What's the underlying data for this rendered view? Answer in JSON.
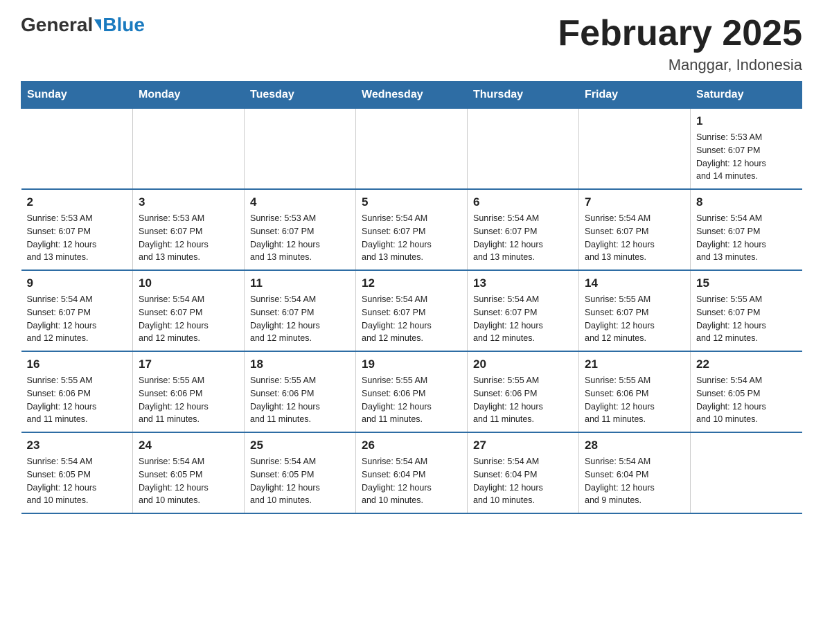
{
  "header": {
    "logo_general": "General",
    "logo_blue": "Blue",
    "title": "February 2025",
    "subtitle": "Manggar, Indonesia"
  },
  "days_of_week": [
    "Sunday",
    "Monday",
    "Tuesday",
    "Wednesday",
    "Thursday",
    "Friday",
    "Saturday"
  ],
  "weeks": [
    [
      {
        "day": "",
        "info": ""
      },
      {
        "day": "",
        "info": ""
      },
      {
        "day": "",
        "info": ""
      },
      {
        "day": "",
        "info": ""
      },
      {
        "day": "",
        "info": ""
      },
      {
        "day": "",
        "info": ""
      },
      {
        "day": "1",
        "info": "Sunrise: 5:53 AM\nSunset: 6:07 PM\nDaylight: 12 hours\nand 14 minutes."
      }
    ],
    [
      {
        "day": "2",
        "info": "Sunrise: 5:53 AM\nSunset: 6:07 PM\nDaylight: 12 hours\nand 13 minutes."
      },
      {
        "day": "3",
        "info": "Sunrise: 5:53 AM\nSunset: 6:07 PM\nDaylight: 12 hours\nand 13 minutes."
      },
      {
        "day": "4",
        "info": "Sunrise: 5:53 AM\nSunset: 6:07 PM\nDaylight: 12 hours\nand 13 minutes."
      },
      {
        "day": "5",
        "info": "Sunrise: 5:54 AM\nSunset: 6:07 PM\nDaylight: 12 hours\nand 13 minutes."
      },
      {
        "day": "6",
        "info": "Sunrise: 5:54 AM\nSunset: 6:07 PM\nDaylight: 12 hours\nand 13 minutes."
      },
      {
        "day": "7",
        "info": "Sunrise: 5:54 AM\nSunset: 6:07 PM\nDaylight: 12 hours\nand 13 minutes."
      },
      {
        "day": "8",
        "info": "Sunrise: 5:54 AM\nSunset: 6:07 PM\nDaylight: 12 hours\nand 13 minutes."
      }
    ],
    [
      {
        "day": "9",
        "info": "Sunrise: 5:54 AM\nSunset: 6:07 PM\nDaylight: 12 hours\nand 12 minutes."
      },
      {
        "day": "10",
        "info": "Sunrise: 5:54 AM\nSunset: 6:07 PM\nDaylight: 12 hours\nand 12 minutes."
      },
      {
        "day": "11",
        "info": "Sunrise: 5:54 AM\nSunset: 6:07 PM\nDaylight: 12 hours\nand 12 minutes."
      },
      {
        "day": "12",
        "info": "Sunrise: 5:54 AM\nSunset: 6:07 PM\nDaylight: 12 hours\nand 12 minutes."
      },
      {
        "day": "13",
        "info": "Sunrise: 5:54 AM\nSunset: 6:07 PM\nDaylight: 12 hours\nand 12 minutes."
      },
      {
        "day": "14",
        "info": "Sunrise: 5:55 AM\nSunset: 6:07 PM\nDaylight: 12 hours\nand 12 minutes."
      },
      {
        "day": "15",
        "info": "Sunrise: 5:55 AM\nSunset: 6:07 PM\nDaylight: 12 hours\nand 12 minutes."
      }
    ],
    [
      {
        "day": "16",
        "info": "Sunrise: 5:55 AM\nSunset: 6:06 PM\nDaylight: 12 hours\nand 11 minutes."
      },
      {
        "day": "17",
        "info": "Sunrise: 5:55 AM\nSunset: 6:06 PM\nDaylight: 12 hours\nand 11 minutes."
      },
      {
        "day": "18",
        "info": "Sunrise: 5:55 AM\nSunset: 6:06 PM\nDaylight: 12 hours\nand 11 minutes."
      },
      {
        "day": "19",
        "info": "Sunrise: 5:55 AM\nSunset: 6:06 PM\nDaylight: 12 hours\nand 11 minutes."
      },
      {
        "day": "20",
        "info": "Sunrise: 5:55 AM\nSunset: 6:06 PM\nDaylight: 12 hours\nand 11 minutes."
      },
      {
        "day": "21",
        "info": "Sunrise: 5:55 AM\nSunset: 6:06 PM\nDaylight: 12 hours\nand 11 minutes."
      },
      {
        "day": "22",
        "info": "Sunrise: 5:54 AM\nSunset: 6:05 PM\nDaylight: 12 hours\nand 10 minutes."
      }
    ],
    [
      {
        "day": "23",
        "info": "Sunrise: 5:54 AM\nSunset: 6:05 PM\nDaylight: 12 hours\nand 10 minutes."
      },
      {
        "day": "24",
        "info": "Sunrise: 5:54 AM\nSunset: 6:05 PM\nDaylight: 12 hours\nand 10 minutes."
      },
      {
        "day": "25",
        "info": "Sunrise: 5:54 AM\nSunset: 6:05 PM\nDaylight: 12 hours\nand 10 minutes."
      },
      {
        "day": "26",
        "info": "Sunrise: 5:54 AM\nSunset: 6:04 PM\nDaylight: 12 hours\nand 10 minutes."
      },
      {
        "day": "27",
        "info": "Sunrise: 5:54 AM\nSunset: 6:04 PM\nDaylight: 12 hours\nand 10 minutes."
      },
      {
        "day": "28",
        "info": "Sunrise: 5:54 AM\nSunset: 6:04 PM\nDaylight: 12 hours\nand 9 minutes."
      },
      {
        "day": "",
        "info": ""
      }
    ]
  ]
}
